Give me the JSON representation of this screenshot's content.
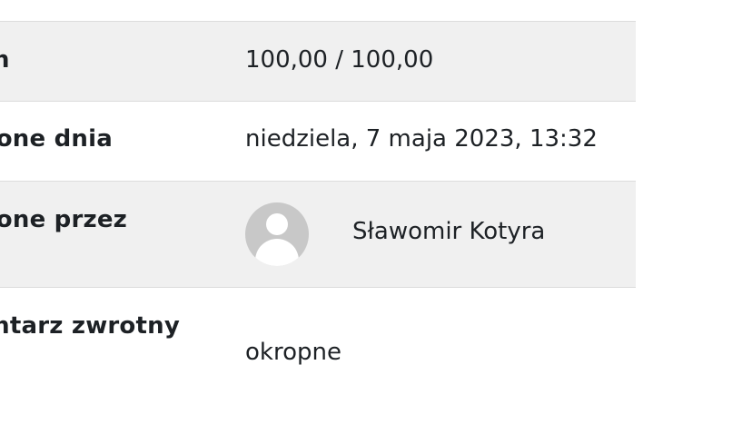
{
  "rows": [
    {
      "label": "n",
      "value": "100,00 / 100,00"
    },
    {
      "label": "one dnia",
      "value": "niedziela, 7 maja 2023, 13:32"
    },
    {
      "label": "one przez",
      "value": "Sławomir Kotyra",
      "avatar_icon": "user-avatar-icon"
    },
    {
      "label": "ntarz zwrotny",
      "value": "okropne"
    }
  ],
  "colors": {
    "row_shaded": "#f0f0f0",
    "border": "#dcdcdc",
    "text": "#1d2125",
    "avatar_bg": "#c8c8c8"
  }
}
